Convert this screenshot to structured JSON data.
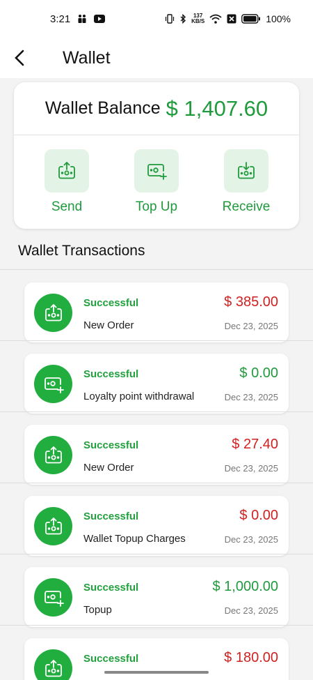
{
  "status_bar": {
    "time": "3:21",
    "speed_value": "137",
    "speed_unit": "KB/S",
    "battery": "100%"
  },
  "header": {
    "title": "Wallet"
  },
  "balance": {
    "label": "Wallet Balance",
    "amount": "$ 1,407.60"
  },
  "actions": [
    {
      "label": "Send",
      "icon": "send-icon"
    },
    {
      "label": "Top Up",
      "icon": "top-up-icon"
    },
    {
      "label": "Receive",
      "icon": "receive-icon"
    }
  ],
  "transactions_title": "Wallet Transactions",
  "transactions": [
    {
      "status": "Successful",
      "description": "New Order",
      "amount": "$ 385.00",
      "amount_color": "red",
      "date": "Dec 23, 2025",
      "icon": "send-icon"
    },
    {
      "status": "Successful",
      "description": "Loyalty point withdrawal",
      "amount": "$ 0.00",
      "amount_color": "green",
      "date": "Dec 23, 2025",
      "icon": "top-up-icon"
    },
    {
      "status": "Successful",
      "description": "New Order",
      "amount": "$ 27.40",
      "amount_color": "red",
      "date": "Dec 23, 2025",
      "icon": "send-icon"
    },
    {
      "status": "Successful",
      "description": "Wallet Topup Charges",
      "amount": "$ 0.00",
      "amount_color": "red",
      "date": "Dec 23, 2025",
      "icon": "send-icon"
    },
    {
      "status": "Successful",
      "description": "Topup",
      "amount": "$ 1,000.00",
      "amount_color": "green",
      "date": "Dec 23, 2025",
      "icon": "top-up-icon"
    },
    {
      "status": "Successful",
      "description": "",
      "amount": "$ 180.00",
      "amount_color": "red",
      "date": "",
      "icon": "send-icon"
    }
  ],
  "colors": {
    "accent_green": "#1f9a3c",
    "debit_red": "#d12020",
    "tile_bg": "#e3f4e6",
    "icon_circle": "#22ad3f"
  }
}
